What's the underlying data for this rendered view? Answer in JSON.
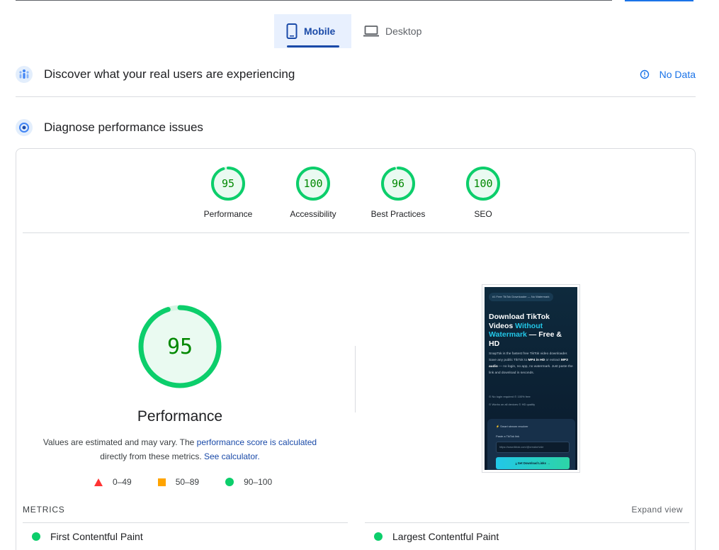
{
  "device_tabs": [
    {
      "label": "Mobile",
      "active": true,
      "icon": "smartphone-icon"
    },
    {
      "label": "Desktop",
      "active": false,
      "icon": "laptop-icon"
    }
  ],
  "real_users": {
    "title": "Discover what your real users are experiencing",
    "status": "No Data"
  },
  "diagnose": {
    "title": "Diagnose performance issues"
  },
  "scores": [
    {
      "label": "Performance",
      "value": 95
    },
    {
      "label": "Accessibility",
      "value": 100
    },
    {
      "label": "Best Practices",
      "value": 96
    },
    {
      "label": "SEO",
      "value": 100
    }
  ],
  "perf": {
    "score": "95",
    "title": "Performance",
    "note_pre": "Values are estimated and may vary. The ",
    "note_link1": "performance score is calculated",
    "note_mid": "directly from these metrics.",
    "note_link2": "See calculator."
  },
  "legend": [
    {
      "shape": "triangle",
      "range": "0–49",
      "color": "#ff3333"
    },
    {
      "shape": "square",
      "range": "50–89",
      "color": "#ffa400"
    },
    {
      "shape": "circle",
      "range": "90–100",
      "color": "#0cce6b"
    }
  ],
  "thumbnail": {
    "badge": "#1 Free TikTok Downloader — No Watermark",
    "heading_1": "Download TikTok Videos ",
    "heading_accent": "Without Watermark",
    "heading_2": " — Free & HD",
    "desc_1": "SnapTok is the fastest free TikTok video downloader. Save any public TikTok to ",
    "desc_b1": "MP4 in HD",
    "desc_2": " or extract ",
    "desc_b2": "MP3 audio",
    "desc_3": " — no login, no app, no watermark. Just paste the link and download in seconds.",
    "feature_1": "⊙ No login required   ⊙ 100% free",
    "feature_2": "⊙ Works on all devices   ⊙ HD quality",
    "box_title": "⚡ Smart stream resolver",
    "box_label": "Paste a TikTok link",
    "input_placeholder": "https://www.tiktok.com/@creator/vide",
    "button": "⤓ Get Download Links →"
  },
  "metrics": {
    "label": "METRICS",
    "expand": "Expand view",
    "items": [
      "First Contentful Paint",
      "Largest Contentful Paint"
    ]
  },
  "colors": {
    "good": "#0cce6b",
    "good_bg": "#eafaf1",
    "good_text": "#008800",
    "accent": "#1a73e8"
  }
}
